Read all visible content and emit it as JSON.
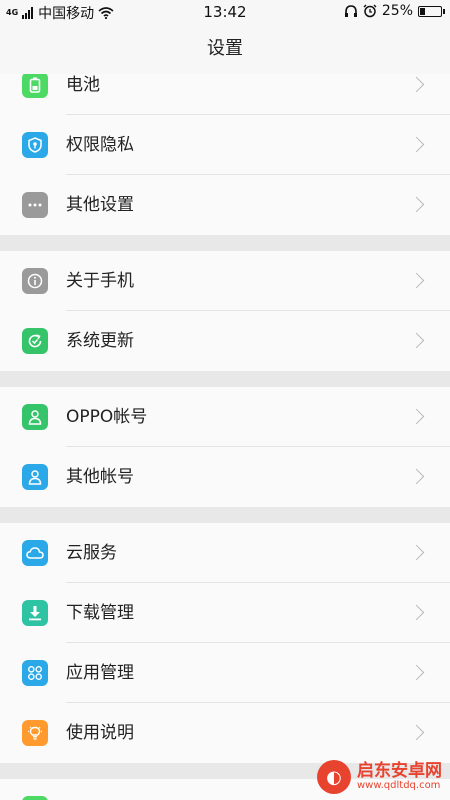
{
  "status_bar": {
    "network_badge": "4G",
    "carrier": "中国移动",
    "time": "13:42",
    "battery_text": "25%",
    "battery_level": 0.25,
    "icons": [
      "signal-icon",
      "wifi-icon",
      "headphone-icon",
      "alarm-icon",
      "battery-icon"
    ]
  },
  "header": {
    "title": "设置"
  },
  "groups": [
    {
      "items": [
        {
          "label": "电池",
          "icon": "battery-icon",
          "color": "#4cd964"
        },
        {
          "label": "权限隐私",
          "icon": "shield-icon",
          "color": "#2aa8e8"
        },
        {
          "label": "其他设置",
          "icon": "more-dots-icon",
          "color": "#9a9a9a"
        }
      ]
    },
    {
      "items": [
        {
          "label": "关于手机",
          "icon": "info-icon",
          "color": "#9a9a9a"
        },
        {
          "label": "系统更新",
          "icon": "update-icon",
          "color": "#35c46a"
        }
      ]
    },
    {
      "items": [
        {
          "label": "OPPO帐号",
          "icon": "person-icon",
          "color": "#35c46a"
        },
        {
          "label": "其他帐号",
          "icon": "person-icon",
          "color": "#2aa8e8"
        }
      ]
    },
    {
      "items": [
        {
          "label": "云服务",
          "icon": "cloud-icon",
          "color": "#2aa8e8"
        },
        {
          "label": "下载管理",
          "icon": "download-icon",
          "color": "#2ec3a3"
        },
        {
          "label": "应用管理",
          "icon": "apps-icon",
          "color": "#2aa8e8"
        },
        {
          "label": "使用说明",
          "icon": "bulb-icon",
          "color": "#ff9a2e"
        }
      ]
    }
  ],
  "watermark": {
    "title": "启东安卓网",
    "url": "www.qdltdq.com",
    "logo_glyph": "◐"
  }
}
